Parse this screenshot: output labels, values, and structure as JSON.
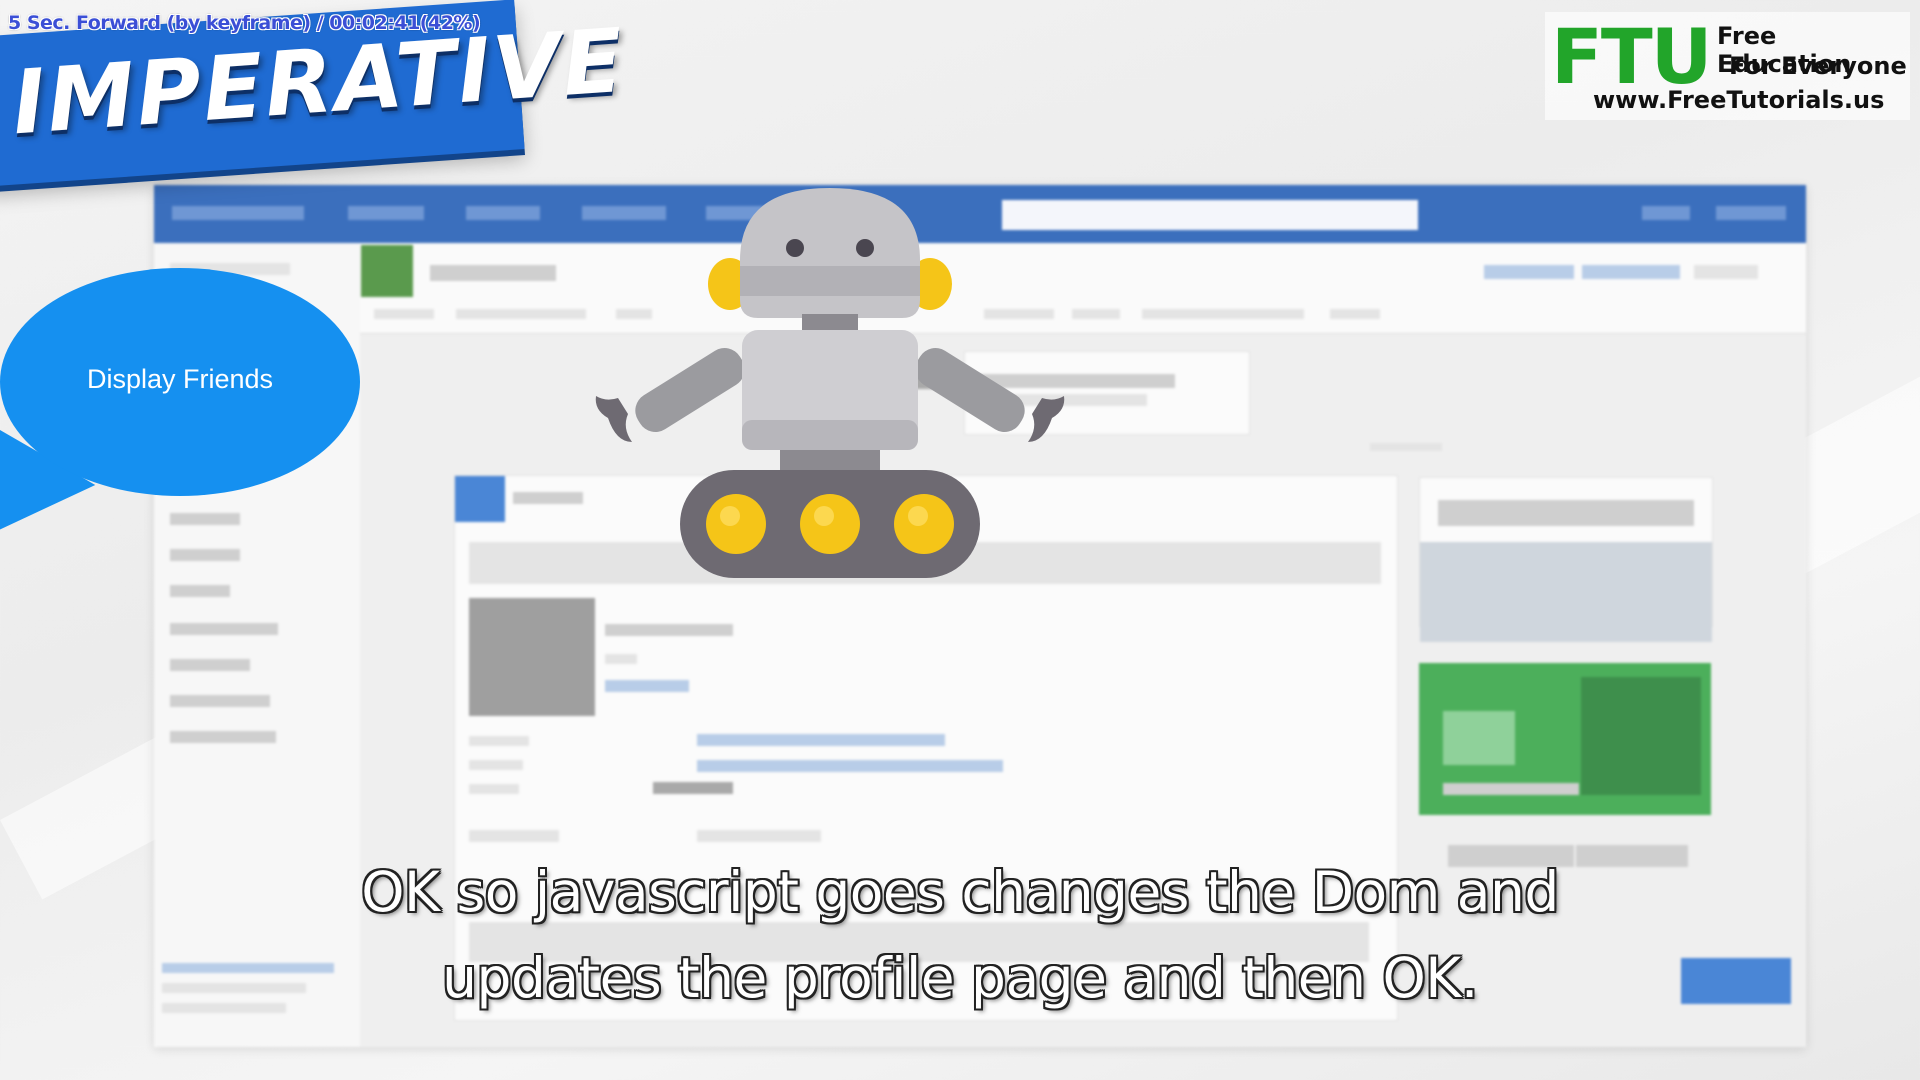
{
  "overlay": {
    "playback_status": "5 Sec. Forward (by keyframe) / 00:02:41(42%)"
  },
  "banner": {
    "title": "IMPERATIVE",
    "color": "#1f6bd2"
  },
  "logo": {
    "brand": "FTU",
    "line1": "Free Education",
    "line2": "For Everyone",
    "url": "www.FreeTutorials.us",
    "brand_color": "#22a52a"
  },
  "bubble": {
    "text": "Display Friends",
    "color": "#1590f0"
  },
  "mockup": {
    "topbar_color": "#3b6fbd",
    "accent_green": "#4caf5b",
    "button_blue": "#4a86d6"
  },
  "robot": {
    "icon": "robot-icon",
    "wheel_color": "#f5c518"
  },
  "subtitles": {
    "line1": "OK so javascript goes changes the Dom and",
    "line2": "updates the profile page and then OK."
  }
}
